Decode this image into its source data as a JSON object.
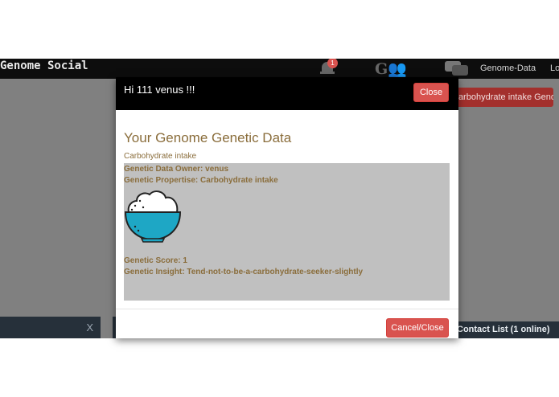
{
  "app": {
    "brand": "Genome Social",
    "notification_count": "1",
    "nav_genome_data": "Genome-Data",
    "nav_logout_partial": "Lo",
    "background_button": "Carbohydrate intake Genome Data",
    "chat_close": "X",
    "contact_list": "Contact List (1 online)"
  },
  "modal": {
    "title": "Hi 111 venus !!!",
    "close_label": "Close",
    "heading": "Your Genome Genetic Data",
    "subheading": "Carbohydrate intake",
    "owner_line": "Genetic Data Owner: venus",
    "propertise_line": "Genetic Propertise: Carbohydrate intake",
    "image_icon": "rice-bowl-icon",
    "score_line": "Genetic Score: 1",
    "insight_line": "Genetic Insight: Tend-not-to-be-a-carbohydrate-seeker-slightly",
    "cancel_label": "Cancel/Close"
  },
  "colors": {
    "navbar": "#0d0d0d",
    "overlay": "#808080",
    "danger": "#d9534f",
    "text_brown": "#8a6d3b",
    "data_box": "#c0c0c0",
    "bowl": "#1ea7c5",
    "chat_bar": "#26303a"
  }
}
